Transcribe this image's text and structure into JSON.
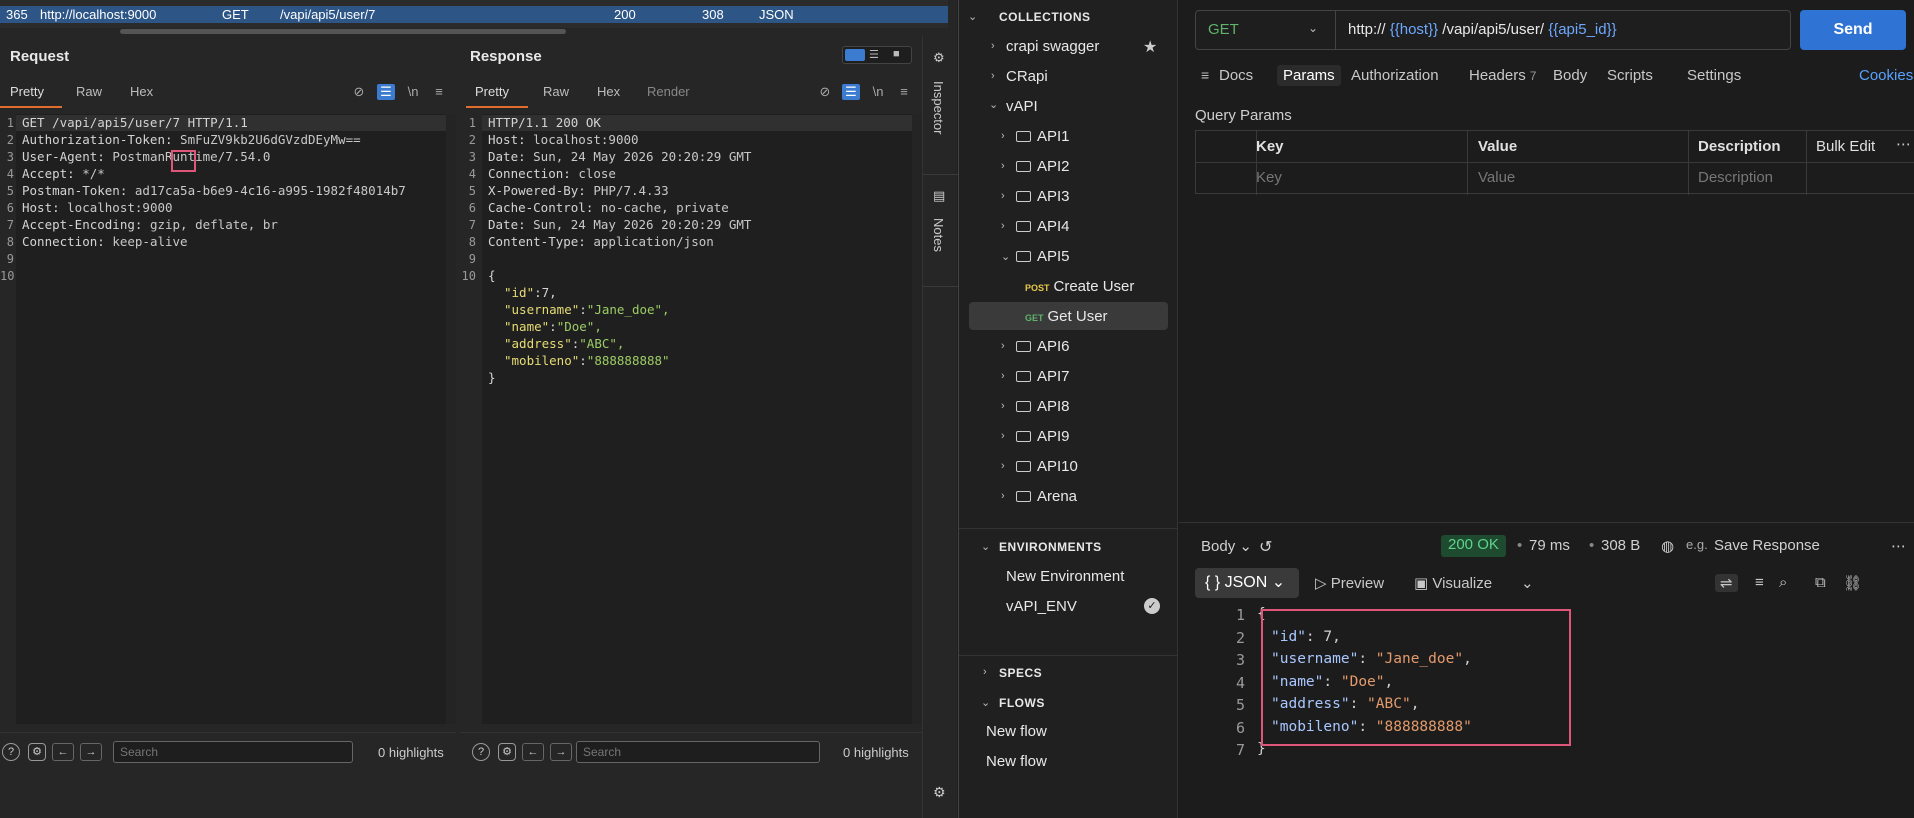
{
  "burp": {
    "history_row": {
      "id": "365",
      "host": "http://localhost:9000",
      "method": "GET",
      "url": "/vapi/api5/user/7",
      "status": "200",
      "length": "308",
      "mime": "JSON"
    },
    "request": {
      "title": "Request",
      "tabs": [
        "Pretty",
        "Raw",
        "Hex"
      ],
      "lines": [
        {
          "k": "GET /vapi/api5/user/7 HTTP/1.1",
          "v": ""
        },
        {
          "k": "Authorization-Token: ",
          "v": "SmFuZV9kb2U6dGVzdDEyMw=="
        },
        {
          "k": "User-Agent: ",
          "v": "PostmanRuntime/7.54.0"
        },
        {
          "k": "Accept: ",
          "v": "*/*"
        },
        {
          "k": "Postman-Token: ",
          "v": "ad17ca5a-b6e9-4c16-a995-1982f48014b7"
        },
        {
          "k": "Host: ",
          "v": "localhost:9000"
        },
        {
          "k": "Accept-Encoding: ",
          "v": "gzip, deflate, br"
        },
        {
          "k": "Connection: ",
          "v": "keep-alive"
        },
        {
          "k": "",
          "v": ""
        },
        {
          "k": "",
          "v": ""
        }
      ],
      "line_numbers": [
        "1",
        "2",
        "3",
        "4",
        "5",
        "6",
        "7",
        "8",
        "9",
        "10"
      ],
      "search_placeholder": "Search",
      "highlights": "0 highlights"
    },
    "response": {
      "title": "Response",
      "tabs": [
        "Pretty",
        "Raw",
        "Hex",
        "Render"
      ],
      "lines": [
        {
          "k": "HTTP/1.1 200 OK",
          "v": ""
        },
        {
          "k": "Host: ",
          "v": "localhost:9000"
        },
        {
          "k": "Date: ",
          "v": "Sun, 24 May 2026 20:20:29 GMT"
        },
        {
          "k": "Connection: ",
          "v": "close"
        },
        {
          "k": "X-Powered-By: ",
          "v": "PHP/7.4.33"
        },
        {
          "k": "Cache-Control: ",
          "v": "no-cache, private"
        },
        {
          "k": "Date: ",
          "v": "Sun, 24 May 2026 20:20:29 GMT"
        },
        {
          "k": "Content-Type: ",
          "v": "application/json"
        },
        {
          "k": "",
          "v": ""
        },
        {
          "k": "{",
          "v": ""
        }
      ],
      "json_lines": [
        {
          "key": "\"id\"",
          "val": "7,",
          "str": false
        },
        {
          "key": "\"username\"",
          "val": "\"Jane_doe\",",
          "str": true
        },
        {
          "key": "\"name\"",
          "val": "\"Doe\",",
          "str": true
        },
        {
          "key": "\"address\"",
          "val": "\"ABC\",",
          "str": true
        },
        {
          "key": "\"mobileno\"",
          "val": "\"888888888\"",
          "str": true
        }
      ],
      "close_brace": "}",
      "line_numbers": [
        "1",
        "2",
        "3",
        "4",
        "5",
        "6",
        "7",
        "8",
        "9",
        "10"
      ],
      "search_placeholder": "Search",
      "highlights": "0 highlights"
    },
    "side_tabs": [
      "Inspector",
      "Notes"
    ]
  },
  "postman": {
    "sidebar": {
      "collections_header": "COLLECTIONS",
      "collections": [
        "crapi swagger",
        "CRapi",
        "vAPI"
      ],
      "folders": [
        "API1",
        "API2",
        "API3",
        "API4",
        "API5"
      ],
      "api5_requests": [
        {
          "method": "POST",
          "name": "Create User",
          "color": "#e8c84a"
        },
        {
          "method": "GET",
          "name": "Get User",
          "color": "#5fb36a"
        }
      ],
      "folders_after": [
        "API6",
        "API7",
        "API8",
        "API9",
        "API10",
        "Arena"
      ],
      "environments_header": "ENVIRONMENTS",
      "environments": [
        "New Environment",
        "vAPI_ENV"
      ],
      "specs_header": "SPECS",
      "flows_header": "FLOWS",
      "flows": [
        "New flow",
        "New flow"
      ]
    },
    "request": {
      "method": "GET",
      "url_prefix": "http://",
      "url_var1": "{{host}}",
      "url_mid": "/vapi/api5/user/",
      "url_var2": "{{api5_id}}",
      "send": "Send",
      "cookies": "Cookies",
      "tabs": [
        {
          "label": "Docs",
          "badge": ""
        },
        {
          "label": "Params",
          "badge": ""
        },
        {
          "label": "Authorization",
          "badge": ""
        },
        {
          "label": "Headers",
          "badge": "7"
        },
        {
          "label": "Body",
          "badge": ""
        },
        {
          "label": "Scripts",
          "badge": ""
        },
        {
          "label": "Settings",
          "badge": ""
        }
      ],
      "query_params_title": "Query Params",
      "qp_headers": {
        "key": "Key",
        "value": "Value",
        "description": "Description",
        "bulk": "Bulk Edit"
      },
      "qp_placeholders": {
        "key": "Key",
        "value": "Value",
        "description": "Description"
      }
    },
    "response": {
      "body_label": "Body",
      "status": "200 OK",
      "time": "79 ms",
      "size": "308 B",
      "save": "Save Response",
      "format": "JSON",
      "preview": "Preview",
      "visualize": "Visualize",
      "open_brace": "{",
      "close_brace": "}",
      "lines": [
        {
          "key": "\"id\"",
          "val": "7",
          "str": false
        },
        {
          "key": "\"username\"",
          "val": "\"Jane_doe\"",
          "str": true
        },
        {
          "key": "\"name\"",
          "val": "\"Doe\"",
          "str": true
        },
        {
          "key": "\"address\"",
          "val": "\"ABC\"",
          "str": true
        },
        {
          "key": "\"mobileno\"",
          "val": "\"888888888\"",
          "str": true
        }
      ],
      "line_numbers": [
        "1",
        "2",
        "3",
        "4",
        "5",
        "6",
        "7"
      ]
    }
  }
}
